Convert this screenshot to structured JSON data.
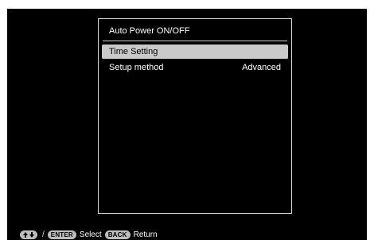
{
  "menu": {
    "title": "Auto Power ON/OFF",
    "items": [
      {
        "label": "Time Setting",
        "value": "",
        "selected": true
      },
      {
        "label": "Setup method",
        "value": "Advanced",
        "selected": false
      }
    ]
  },
  "footer": {
    "nav_icon": "up-down-arrows-icon",
    "enter_label": "ENTER",
    "select_label": "Select",
    "back_label": "BACK",
    "return_label": "Return"
  },
  "colors": {
    "background": "#000000",
    "highlight": "#c9c9c9",
    "text": "#ffffff"
  }
}
